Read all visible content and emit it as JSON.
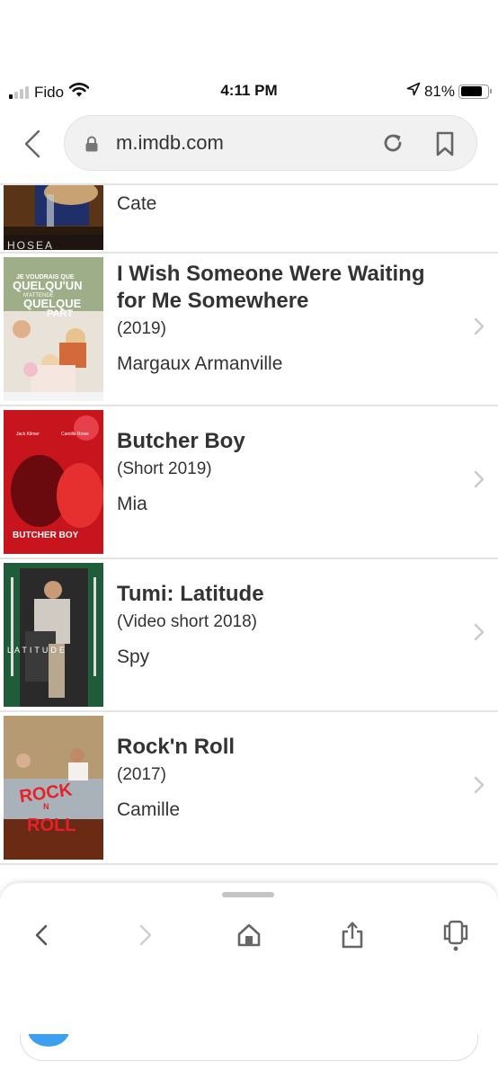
{
  "status_bar": {
    "carrier": "Fido",
    "time": "4:11 PM",
    "battery_percent": "81%",
    "battery_level": 0.81,
    "signal_bars_active": 1,
    "signal_bars_total": 4,
    "icons": [
      "signal-icon",
      "wifi-icon",
      "location-arrow-icon",
      "battery-icon"
    ]
  },
  "browser": {
    "url": "m.imdb.com",
    "icons": [
      "back-icon",
      "lock-icon",
      "reload-icon",
      "bookmark-icon"
    ]
  },
  "filmography": [
    {
      "title": "",
      "meta": "",
      "role": "Cate",
      "poster_caption": "HOSEA",
      "poster_colors": [
        "#5a3416",
        "#1f2f6a",
        "#2a1a0e"
      ]
    },
    {
      "title": "I Wish Someone Were Waiting for Me Somewhere",
      "meta": "(2019)",
      "role": "Margaux Armanville",
      "poster_caption": "JE VOUDRAIS QUE QUELQU'UN M'ATTENDE QUELQUE PART",
      "poster_colors": [
        "#e8e2d8",
        "#6a8c55",
        "#d26a3a"
      ]
    },
    {
      "title": "Butcher Boy",
      "meta": "(Short 2019)",
      "role": "Mia",
      "poster_caption": "BUTCHER BOY",
      "poster_colors": [
        "#c8141c",
        "#6a0a0e",
        "#e63030"
      ]
    },
    {
      "title": "Tumi: Latitude",
      "meta": "(Video short 2018)",
      "role": "Spy",
      "poster_caption": "LATITUDE",
      "poster_colors": [
        "#1f5c3a",
        "#2a2a2a",
        "#cfcac2"
      ]
    },
    {
      "title": "Rock'n Roll",
      "meta": "(2017)",
      "role": "Camille",
      "poster_caption": "ROCK N ROLL",
      "poster_colors": [
        "#b59a72",
        "#a9b2b8",
        "#6a2a14"
      ]
    }
  ],
  "toolbar": {
    "items": [
      {
        "name": "back-button",
        "icon": "chevron-left-icon",
        "enabled": true
      },
      {
        "name": "forward-button",
        "icon": "chevron-right-icon",
        "enabled": false
      },
      {
        "name": "home-button",
        "icon": "home-icon",
        "enabled": true
      },
      {
        "name": "share-button",
        "icon": "share-icon",
        "enabled": true
      },
      {
        "name": "tabs-button",
        "icon": "tabs-icon",
        "enabled": true
      }
    ]
  },
  "colors": {
    "text": "#333333",
    "divider": "#e4e4e4",
    "url_bar_bg": "#f1f1f1",
    "icon_gray": "#666666",
    "chevron_light": "#cccccc",
    "accent_blue": "#3d9fef"
  }
}
